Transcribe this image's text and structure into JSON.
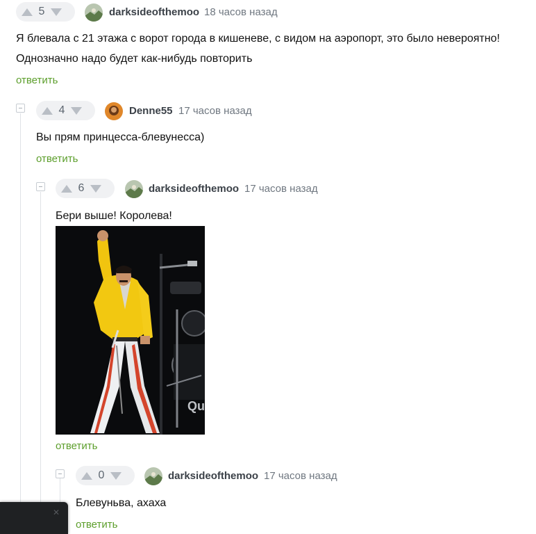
{
  "comments": [
    {
      "votes": "5",
      "username": "darksideofthemoo",
      "time": "18 часов назад",
      "text_lines": [
        "Я блевала с 21 этажа с ворот города в кишеневе, с видом на аэропорт, это было невероятно!",
        "Однозначно надо будет как-нибудь повторить"
      ],
      "reply_label": "ответить"
    },
    {
      "votes": "4",
      "username": "Denne55",
      "time": "17 часов назад",
      "text": "Вы прям принцесса-блевунесса)",
      "reply_label": "ответить"
    },
    {
      "votes": "6",
      "username": "darksideofthemoo",
      "time": "17 часов назад",
      "text": "Бери выше! Королева!",
      "reply_label": "ответить"
    },
    {
      "votes": "0",
      "username": "darksideofthemoo",
      "time": "17 часов назад",
      "text": "Блевуньва, ахаха",
      "reply_label": "ответить"
    }
  ],
  "photo_banner_text": "Qu",
  "colors": {
    "reply_link": "#5c9e2b",
    "vote_bg": "#f0f1f3",
    "arrow": "#b9bec5",
    "username": "#3b4148",
    "time": "#6f7780"
  },
  "icons": [
    "upvote-icon",
    "downvote-icon",
    "collapse-icon",
    "avatar-icon"
  ]
}
